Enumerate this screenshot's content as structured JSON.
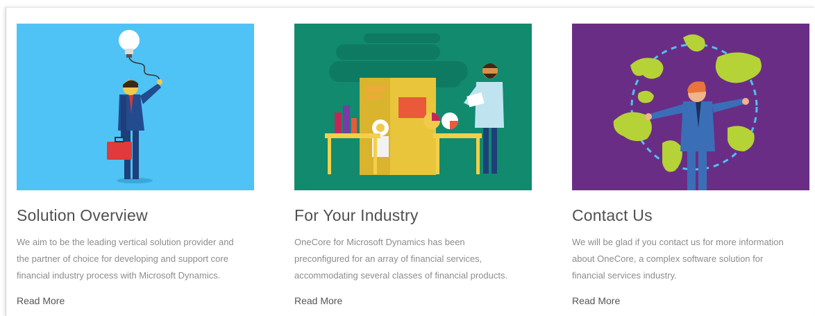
{
  "colors": {
    "card1_bg": "#4fc3f5",
    "card2_bg": "#118a6e",
    "card3_bg": "#6a2d85",
    "title": "#505050",
    "body": "#8c8c8c",
    "link": "#555555"
  },
  "cards": [
    {
      "title": "Solution Overview",
      "image_icon": "businessman-lightbulb-illustration",
      "lines": [
        "We aim to be the leading vertical solution provider and",
        "the partner of choice for developing and support core",
        "financial industry process with Microsoft Dynamics."
      ],
      "link": "Read More"
    },
    {
      "title": "For Your Industry",
      "image_icon": "analyst-factory-illustration",
      "lines": [
        "OneCore for Microsoft Dynamics has been",
        "preconfigured for an array of financial services,",
        "accommodating several classes of financial products."
      ],
      "link": "Read More"
    },
    {
      "title": "Contact Us",
      "image_icon": "businessman-world-map-illustration",
      "lines": [
        "We will be glad if you contact us for more information",
        "about OneCore, a complex software solution for",
        "financial services industry."
      ],
      "link": "Read More"
    }
  ]
}
